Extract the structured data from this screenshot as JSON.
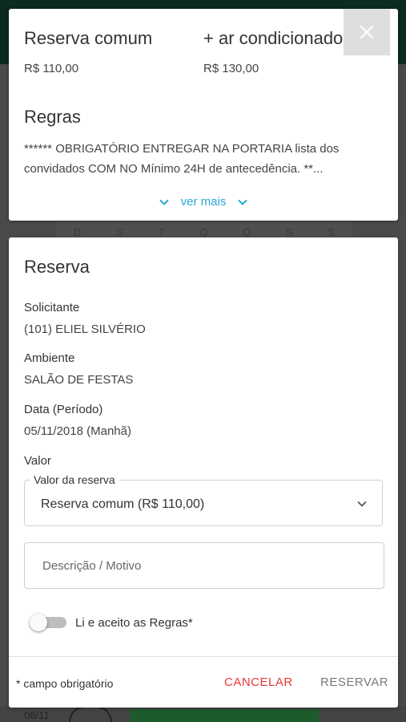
{
  "background": {
    "weekdays": [
      "D",
      "S",
      "T",
      "Q",
      "Q",
      "S",
      "S"
    ],
    "date_label": "06/11"
  },
  "prices": [
    {
      "name": "Reserva comum",
      "value": "R$ 110,00"
    },
    {
      "name": "+ ar condicionado",
      "value": "R$ 130,00"
    }
  ],
  "rules": {
    "title": "Regras",
    "text": "****** OBRIGATÓRIO ENTREGAR NA PORTARIA lista dos convidados COM NO Mínimo 24H de antecedência. **...",
    "more_label": "ver mais"
  },
  "reservation": {
    "title": "Reserva",
    "fields": [
      {
        "label": "Solicitante",
        "value": "(101) ELIEL SILVÉRIO"
      },
      {
        "label": "Ambiente",
        "value": "SALÃO DE FESTAS"
      },
      {
        "label": "Data (Período)",
        "value": "05/11/2018 (Manhã)"
      }
    ],
    "valor_label": "Valor",
    "select": {
      "legend": "Valor da reserva",
      "selected": "Reserva comum (R$ 110,00)"
    },
    "description": {
      "placeholder": "Descrição / Motivo",
      "value": ""
    },
    "accept_rules": {
      "label": "Li e aceito as Regras*",
      "checked": false
    },
    "required_note": "* campo obrigatório",
    "cancel_label": "CANCELAR",
    "reserve_label": "RESERVAR"
  },
  "colors": {
    "accent_link": "#2ba9d6",
    "cancel": "#e53935",
    "disabled_action": "#7a7a7a"
  },
  "icons": {
    "close": "close-icon",
    "expand": "chevron-down-icon",
    "lock": "lock-icon"
  }
}
